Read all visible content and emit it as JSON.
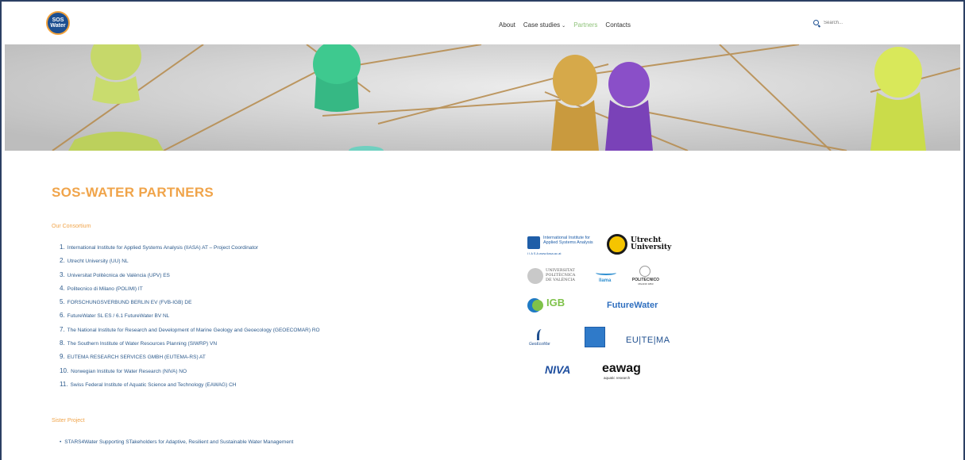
{
  "header": {
    "logo_line1": "SOS",
    "logo_line2": "Water",
    "nav": {
      "about": "About",
      "case_studies": "Case studies",
      "partners": "Partners",
      "contacts": "Contacts"
    },
    "search_placeholder": "Search..."
  },
  "page_title": "SOS-WATER PARTNERS",
  "consortium": {
    "heading": "Our Consortium",
    "items": [
      {
        "num": "1.",
        "text": "International Institute for Applied Systems Analysis (IIASA) AT – Project Coordinator"
      },
      {
        "num": "2.",
        "text": "Utrecht University (UU) NL"
      },
      {
        "num": "3.",
        "text": "Universitat Politècnica de València (UPV) ES"
      },
      {
        "num": "4.",
        "text": "Politecnico di Milano (POLIMI) IT"
      },
      {
        "num": "5.",
        "text": "FORSCHUNGSVERBUND BERLIN EV (FVB-IGB) DE"
      },
      {
        "num": "6.",
        "text": "FutureWater SL ES / 6.1 FutureWater BV NL"
      },
      {
        "num": "7.",
        "text": "The National Institute for Research and Development of Marine Geology and Geoecology (GEOECOMAR) RO"
      },
      {
        "num": "8.",
        "text": "The Southern Institute of Water Resources Planning (SIWRP) VN"
      },
      {
        "num": "9.",
        "text": "EUTEMA RESEARCH SERVICES GMBH (EUTEMA-RS) AT"
      },
      {
        "num": "10.",
        "text": "Norwegian Institute for Water Research (NIVA) NO"
      },
      {
        "num": "11.",
        "text": "Swiss Federal Institute of Aquatic Science and Technology (EAWAG) CH"
      }
    ]
  },
  "sister": {
    "heading": "Sister Project",
    "items": [
      {
        "text": "STARS4Water Supporting STakeholders for Adaptive, Resilient and Sustainable Water Management"
      }
    ]
  },
  "partner_logos": {
    "iiasa_line1": "International Institute for",
    "iiasa_line2": "Applied Systems Analysis",
    "iiasa_line3": "I I A S A  www.iiasa.ac.at",
    "uu_line1": "Utrecht",
    "uu_line2": "University",
    "upv_line1": "UNIVERSITAT",
    "upv_line2": "POLITÈCNICA",
    "upv_line3": "DE VALÈNCIA",
    "llama": "llama",
    "polimi_line1": "POLITECNICO",
    "polimi_line2": "MILANO 1863",
    "igb": "IGB",
    "futurewater": "FutureWater",
    "geoecomar": "GeoEcoMar",
    "eutema": "EU|TE|MA",
    "niva": "NIVA",
    "eawag": "eawag",
    "eawag_sub": "aquatic research"
  },
  "colors": {
    "accent_orange": "#f0a44a",
    "link_blue": "#2c5a8c",
    "nav_active": "#8fc37a"
  }
}
